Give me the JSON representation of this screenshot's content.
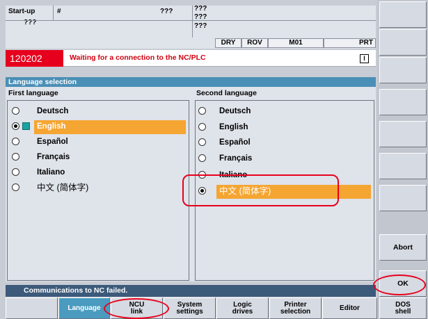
{
  "header": {
    "row1": [
      "Start-up",
      "#",
      "???",
      "???"
    ],
    "row1b": [
      "???"
    ],
    "row2": [
      "???",
      "???"
    ],
    "status": [
      "DRY",
      "ROV",
      "M01",
      "PRT"
    ]
  },
  "alarm": {
    "number": "120202",
    "message": "Waiting for a connection to the NC/PLC",
    "indicator": "I"
  },
  "dialog": {
    "title": "Language selection",
    "first_label": "First language",
    "second_label": "Second language",
    "first_items": [
      {
        "label": "Deutsch",
        "checked": false
      },
      {
        "label": "English",
        "checked": true
      },
      {
        "label": "Español",
        "checked": false
      },
      {
        "label": "Français",
        "checked": false
      },
      {
        "label": "Italiano",
        "checked": false
      },
      {
        "label": "中文 (简体字)",
        "checked": false
      }
    ],
    "second_items": [
      {
        "label": "Deutsch",
        "checked": false
      },
      {
        "label": "English",
        "checked": false
      },
      {
        "label": "Español",
        "checked": false
      },
      {
        "label": "Français",
        "checked": false
      },
      {
        "label": "Italiano",
        "checked": false
      },
      {
        "label": "中文 (简体字)",
        "checked": true
      }
    ]
  },
  "status_bar": "Communications to NC failed.",
  "vertical_softkeys": [
    "",
    "",
    "",
    "",
    "",
    "",
    "",
    "Abort",
    "OK"
  ],
  "horizontal_softkeys": [
    "",
    "Language",
    "NCU\nlink",
    "System\nsettings",
    "Logic\ndrives",
    "Printer\nselection",
    "Editor",
    "DOS\nshell"
  ],
  "colors": {
    "selection": "#f5a531",
    "alarm_red": "#e6001e",
    "title_blue": "#4a8fb6",
    "annotation": "#e8001c"
  }
}
